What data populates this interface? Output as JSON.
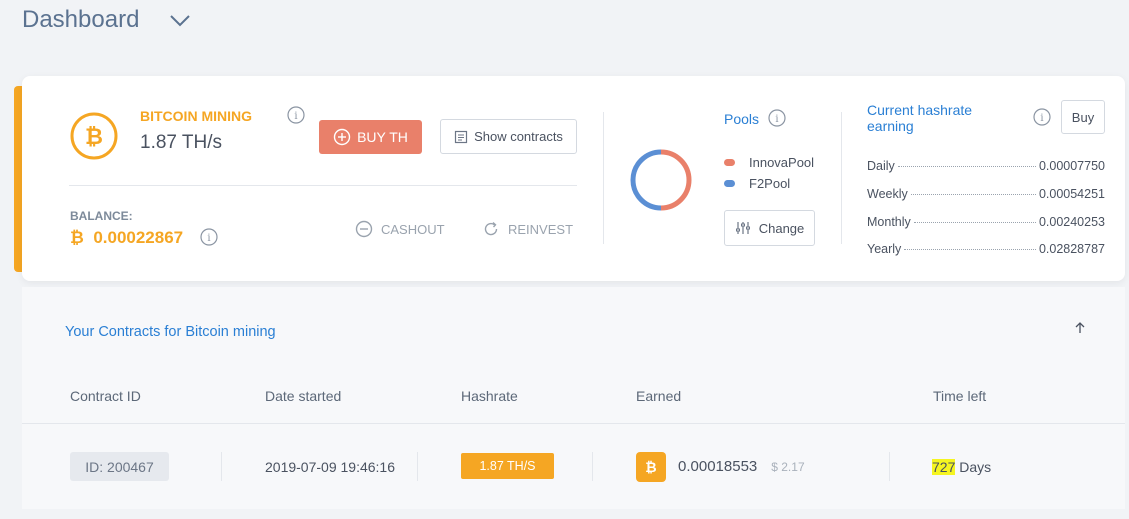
{
  "header": {
    "title": "Dashboard",
    "dropdown_icon": "chevron-down-icon"
  },
  "mining": {
    "title": "BITCOIN MINING",
    "hashrate": "1.87 TH/s",
    "buy_label": "BUY TH",
    "show_contracts_label": "Show contracts",
    "balance_label": "BALANCE:",
    "balance_symbol": "₿",
    "balance_value": "0.00022867",
    "cashout_label": "CASHOUT",
    "reinvest_label": "REINVEST",
    "accent_color": "#f5a623"
  },
  "pools": {
    "title": "Pools",
    "items": [
      {
        "name": "InnovaPool",
        "color": "#e9806a",
        "share": 0.5
      },
      {
        "name": "F2Pool",
        "color": "#5b8fd4",
        "share": 0.5
      }
    ],
    "change_label": "Change"
  },
  "earning": {
    "title": "Current hashrate earning",
    "buy_label": "Buy",
    "rows": [
      {
        "period": "Daily",
        "value": "0.00007750"
      },
      {
        "period": "Weekly",
        "value": "0.00054251"
      },
      {
        "period": "Monthly",
        "value": "0.00240253"
      },
      {
        "period": "Yearly",
        "value": "0.02828787"
      }
    ]
  },
  "contracts": {
    "title": "Your Contracts for Bitcoin mining",
    "columns": [
      "Contract ID",
      "Date started",
      "Hashrate",
      "Earned",
      "Time left"
    ],
    "rows": [
      {
        "id": "ID: 200467",
        "date_started": "2019-07-09 19:46:16",
        "hashrate": "1.87 TH/S",
        "earned": "0.00018553",
        "earned_usd": "$ 2.17",
        "time_left_value": "727",
        "time_left_unit": "Days"
      }
    ]
  }
}
